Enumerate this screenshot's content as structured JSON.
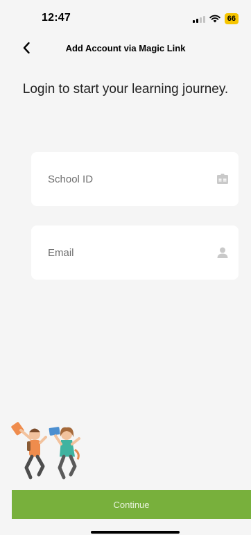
{
  "status_bar": {
    "time": "12:47",
    "battery": "66",
    "battery_color": "#f6c500",
    "icons": [
      "signal-icon",
      "wifi-icon"
    ]
  },
  "nav": {
    "title": "Add Account via Magic Link",
    "back_icon": "chevron-left-icon"
  },
  "headline": "Login to start your learning journey.",
  "form": {
    "school_id": {
      "placeholder": "School ID",
      "value": "",
      "icon": "id-card-icon"
    },
    "email": {
      "placeholder": "Email",
      "value": "",
      "icon": "person-icon"
    }
  },
  "continue_label": "Continue",
  "accent_color": "#78b03c",
  "illustration": "students-jumping-illustration"
}
